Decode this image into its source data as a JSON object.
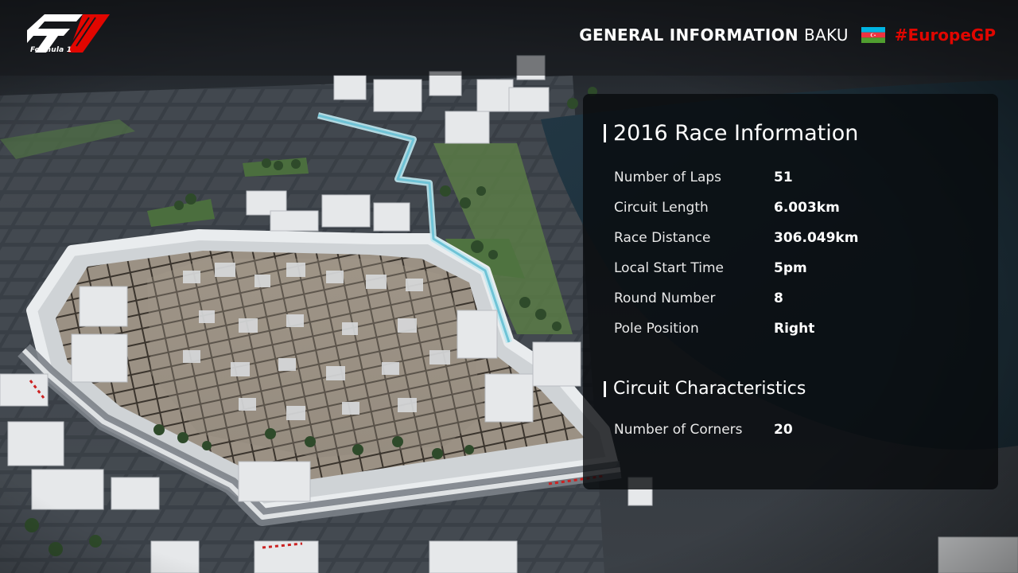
{
  "brand": {
    "logo_text": "Formula 1",
    "accent_color": "#e10600"
  },
  "header": {
    "title": "GENERAL INFORMATION",
    "city": "BAKU",
    "flag_icon": "azerbaijan-flag-icon",
    "hashtag": "#EuropeGP"
  },
  "race_info": {
    "title": "2016 Race Information",
    "rows": [
      {
        "label": "Number of Laps",
        "value": "51"
      },
      {
        "label": "Circuit Length",
        "value": "6.003km"
      },
      {
        "label": "Race Distance",
        "value": "306.049km"
      },
      {
        "label": "Local Start Time",
        "value": "5pm"
      },
      {
        "label": "Round Number",
        "value": "8"
      },
      {
        "label": "Pole Position",
        "value": "Right"
      }
    ]
  },
  "circuit": {
    "title": "Circuit Characteristics",
    "rows": [
      {
        "label": "Number of Corners",
        "value": "20"
      }
    ]
  }
}
